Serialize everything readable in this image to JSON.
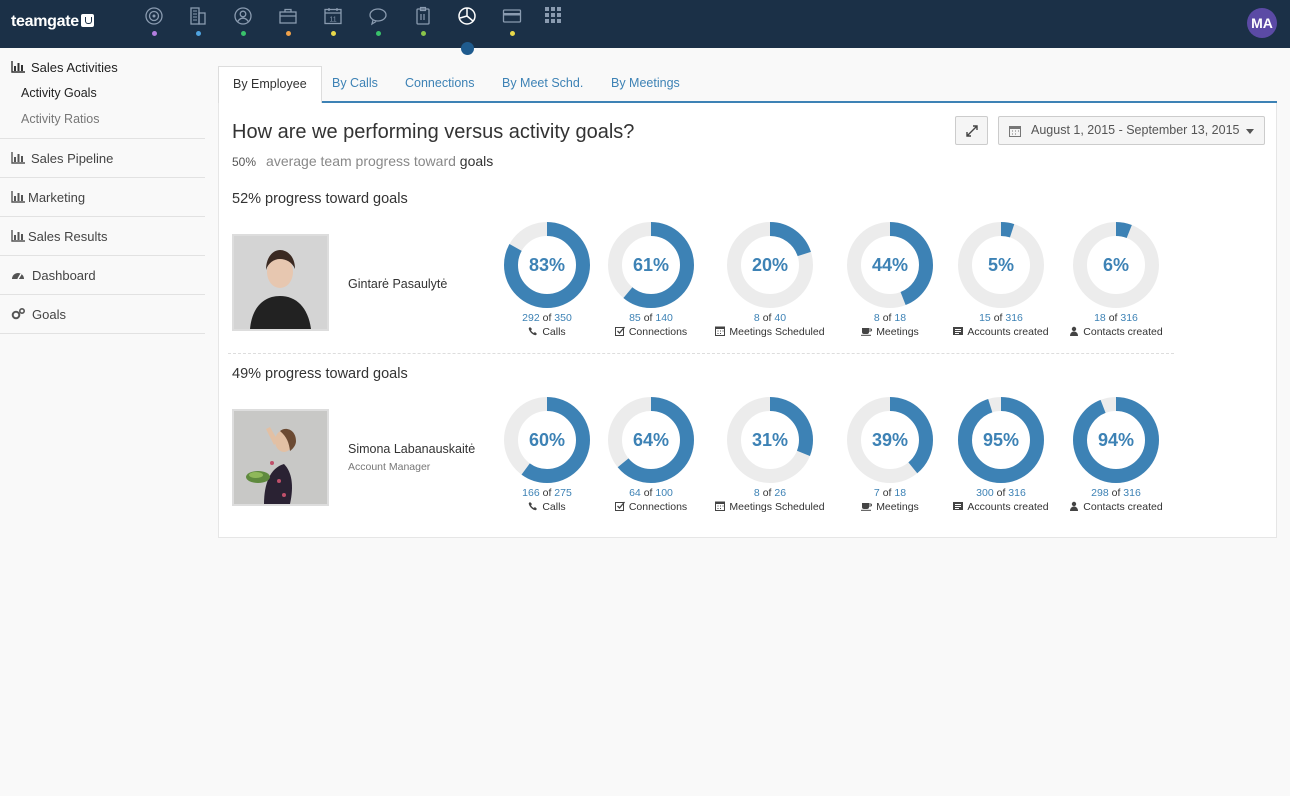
{
  "app": {
    "logo_text": "teamgate",
    "user_initials": "MA"
  },
  "topnav": {
    "items": [
      {
        "icon": "target-icon",
        "dot": "#b37ee0"
      },
      {
        "icon": "building-icon",
        "dot": "#4fa3e0"
      },
      {
        "icon": "person-circle-icon",
        "dot": "#39c26b"
      },
      {
        "icon": "briefcase-icon",
        "dot": "#f0a24a"
      },
      {
        "icon": "calendar-icon",
        "dot": "#e8d84a",
        "text": "11"
      },
      {
        "icon": "chat-icon",
        "dot": "#39c26b"
      },
      {
        "icon": "clipboard-icon",
        "dot": "#8ac44a"
      },
      {
        "icon": "pie-chart-icon",
        "dot": null,
        "active": true
      },
      {
        "icon": "credit-card-icon",
        "dot": "#e8d84a"
      },
      {
        "icon": "grid-icon",
        "dot": null
      }
    ]
  },
  "sidebar": {
    "sales_activities": "Sales Activities",
    "activity_goals": "Activity Goals",
    "activity_ratios": "Activity Ratios",
    "sales_pipeline": "Sales Pipeline",
    "marketing": "Marketing",
    "sales_results": "Sales Results",
    "dashboard": "Dashboard",
    "goals": "Goals"
  },
  "tabs": [
    "By Employee",
    "By Calls",
    "Connections",
    "By Meet Schd.",
    "By Meetings"
  ],
  "main": {
    "title": "How are we performing versus activity goals?",
    "avg_pct": "50%",
    "avg_text": "average team progress toward",
    "avg_goals": "goals",
    "date_range": "August 1, 2015 - September 13, 2015"
  },
  "employees": [
    {
      "heading": "52% progress toward goals",
      "name": "Gintarė Pasaulytė",
      "role": "",
      "metrics": [
        {
          "pct": "83%",
          "frac": 0.83,
          "done": "292",
          "of": "of",
          "total": "350",
          "label": "Calls",
          "icon": "phone-icon"
        },
        {
          "pct": "61%",
          "frac": 0.61,
          "done": "85",
          "of": "of",
          "total": "140",
          "label": "Connections",
          "icon": "checkbox-icon"
        },
        {
          "pct": "20%",
          "frac": 0.2,
          "done": "8",
          "of": "of",
          "total": "40",
          "label": "Meetings Scheduled",
          "icon": "calendar-icon"
        },
        {
          "pct": "44%",
          "frac": 0.44,
          "done": "8",
          "of": "of",
          "total": "18",
          "label": "Meetings",
          "icon": "coffee-icon"
        },
        {
          "pct": "5%",
          "frac": 0.05,
          "done": "15",
          "of": "of",
          "total": "316",
          "label": "Accounts created",
          "icon": "list-icon"
        },
        {
          "pct": "6%",
          "frac": 0.06,
          "done": "18",
          "of": "of",
          "total": "316",
          "label": "Contacts created",
          "icon": "user-icon"
        }
      ]
    },
    {
      "heading": "49% progress toward goals",
      "name": "Simona Labanauskaitė",
      "role": "Account Manager",
      "metrics": [
        {
          "pct": "60%",
          "frac": 0.6,
          "done": "166",
          "of": "of",
          "total": "275",
          "label": "Calls",
          "icon": "phone-icon"
        },
        {
          "pct": "64%",
          "frac": 0.64,
          "done": "64",
          "of": "of",
          "total": "100",
          "label": "Connections",
          "icon": "checkbox-icon"
        },
        {
          "pct": "31%",
          "frac": 0.31,
          "done": "8",
          "of": "of",
          "total": "26",
          "label": "Meetings Scheduled",
          "icon": "calendar-icon"
        },
        {
          "pct": "39%",
          "frac": 0.39,
          "done": "7",
          "of": "of",
          "total": "18",
          "label": "Meetings",
          "icon": "coffee-icon"
        },
        {
          "pct": "95%",
          "frac": 0.95,
          "done": "300",
          "of": "of",
          "total": "316",
          "label": "Accounts created",
          "icon": "list-icon"
        },
        {
          "pct": "94%",
          "frac": 0.94,
          "done": "298",
          "of": "of",
          "total": "316",
          "label": "Contacts created",
          "icon": "user-icon"
        }
      ]
    }
  ],
  "colors": {
    "accent": "#3d82b5",
    "ring_bg": "#ececec",
    "topbar": "#1b3047"
  }
}
